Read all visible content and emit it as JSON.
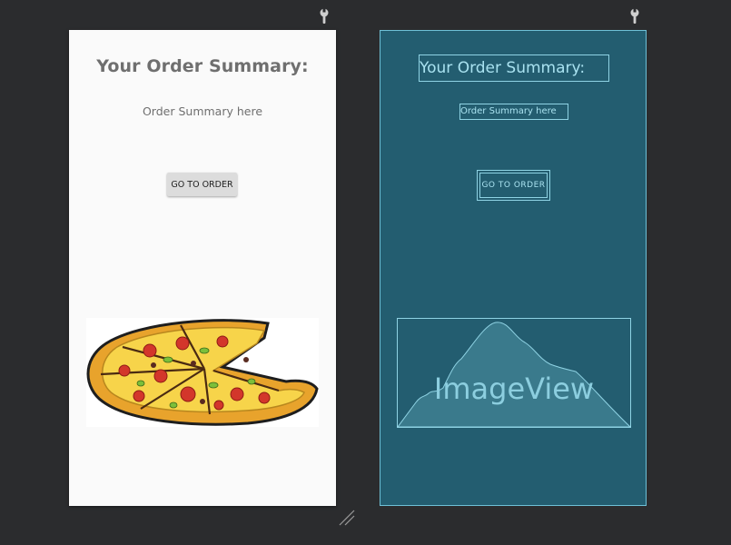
{
  "design": {
    "title": "Your Order Summary:",
    "summary_text": "Order Summary here",
    "button_label": "GO TO ORDER",
    "image_icon": "pizza-image"
  },
  "blueprint": {
    "title": "Your Order Summary:",
    "summary_text": "Order Summary here",
    "button_label": "GO TO ORDER",
    "image_label": "ImageView"
  },
  "icons": [
    "wrench-icon",
    "resize-handle-icon"
  ],
  "colors": {
    "canvas_background": "#2b2c2e",
    "design_background": "#fafafa",
    "blueprint_background": "#235d70",
    "blueprint_outline": "#8fd3e4",
    "button_background": "#dcdcdc"
  }
}
